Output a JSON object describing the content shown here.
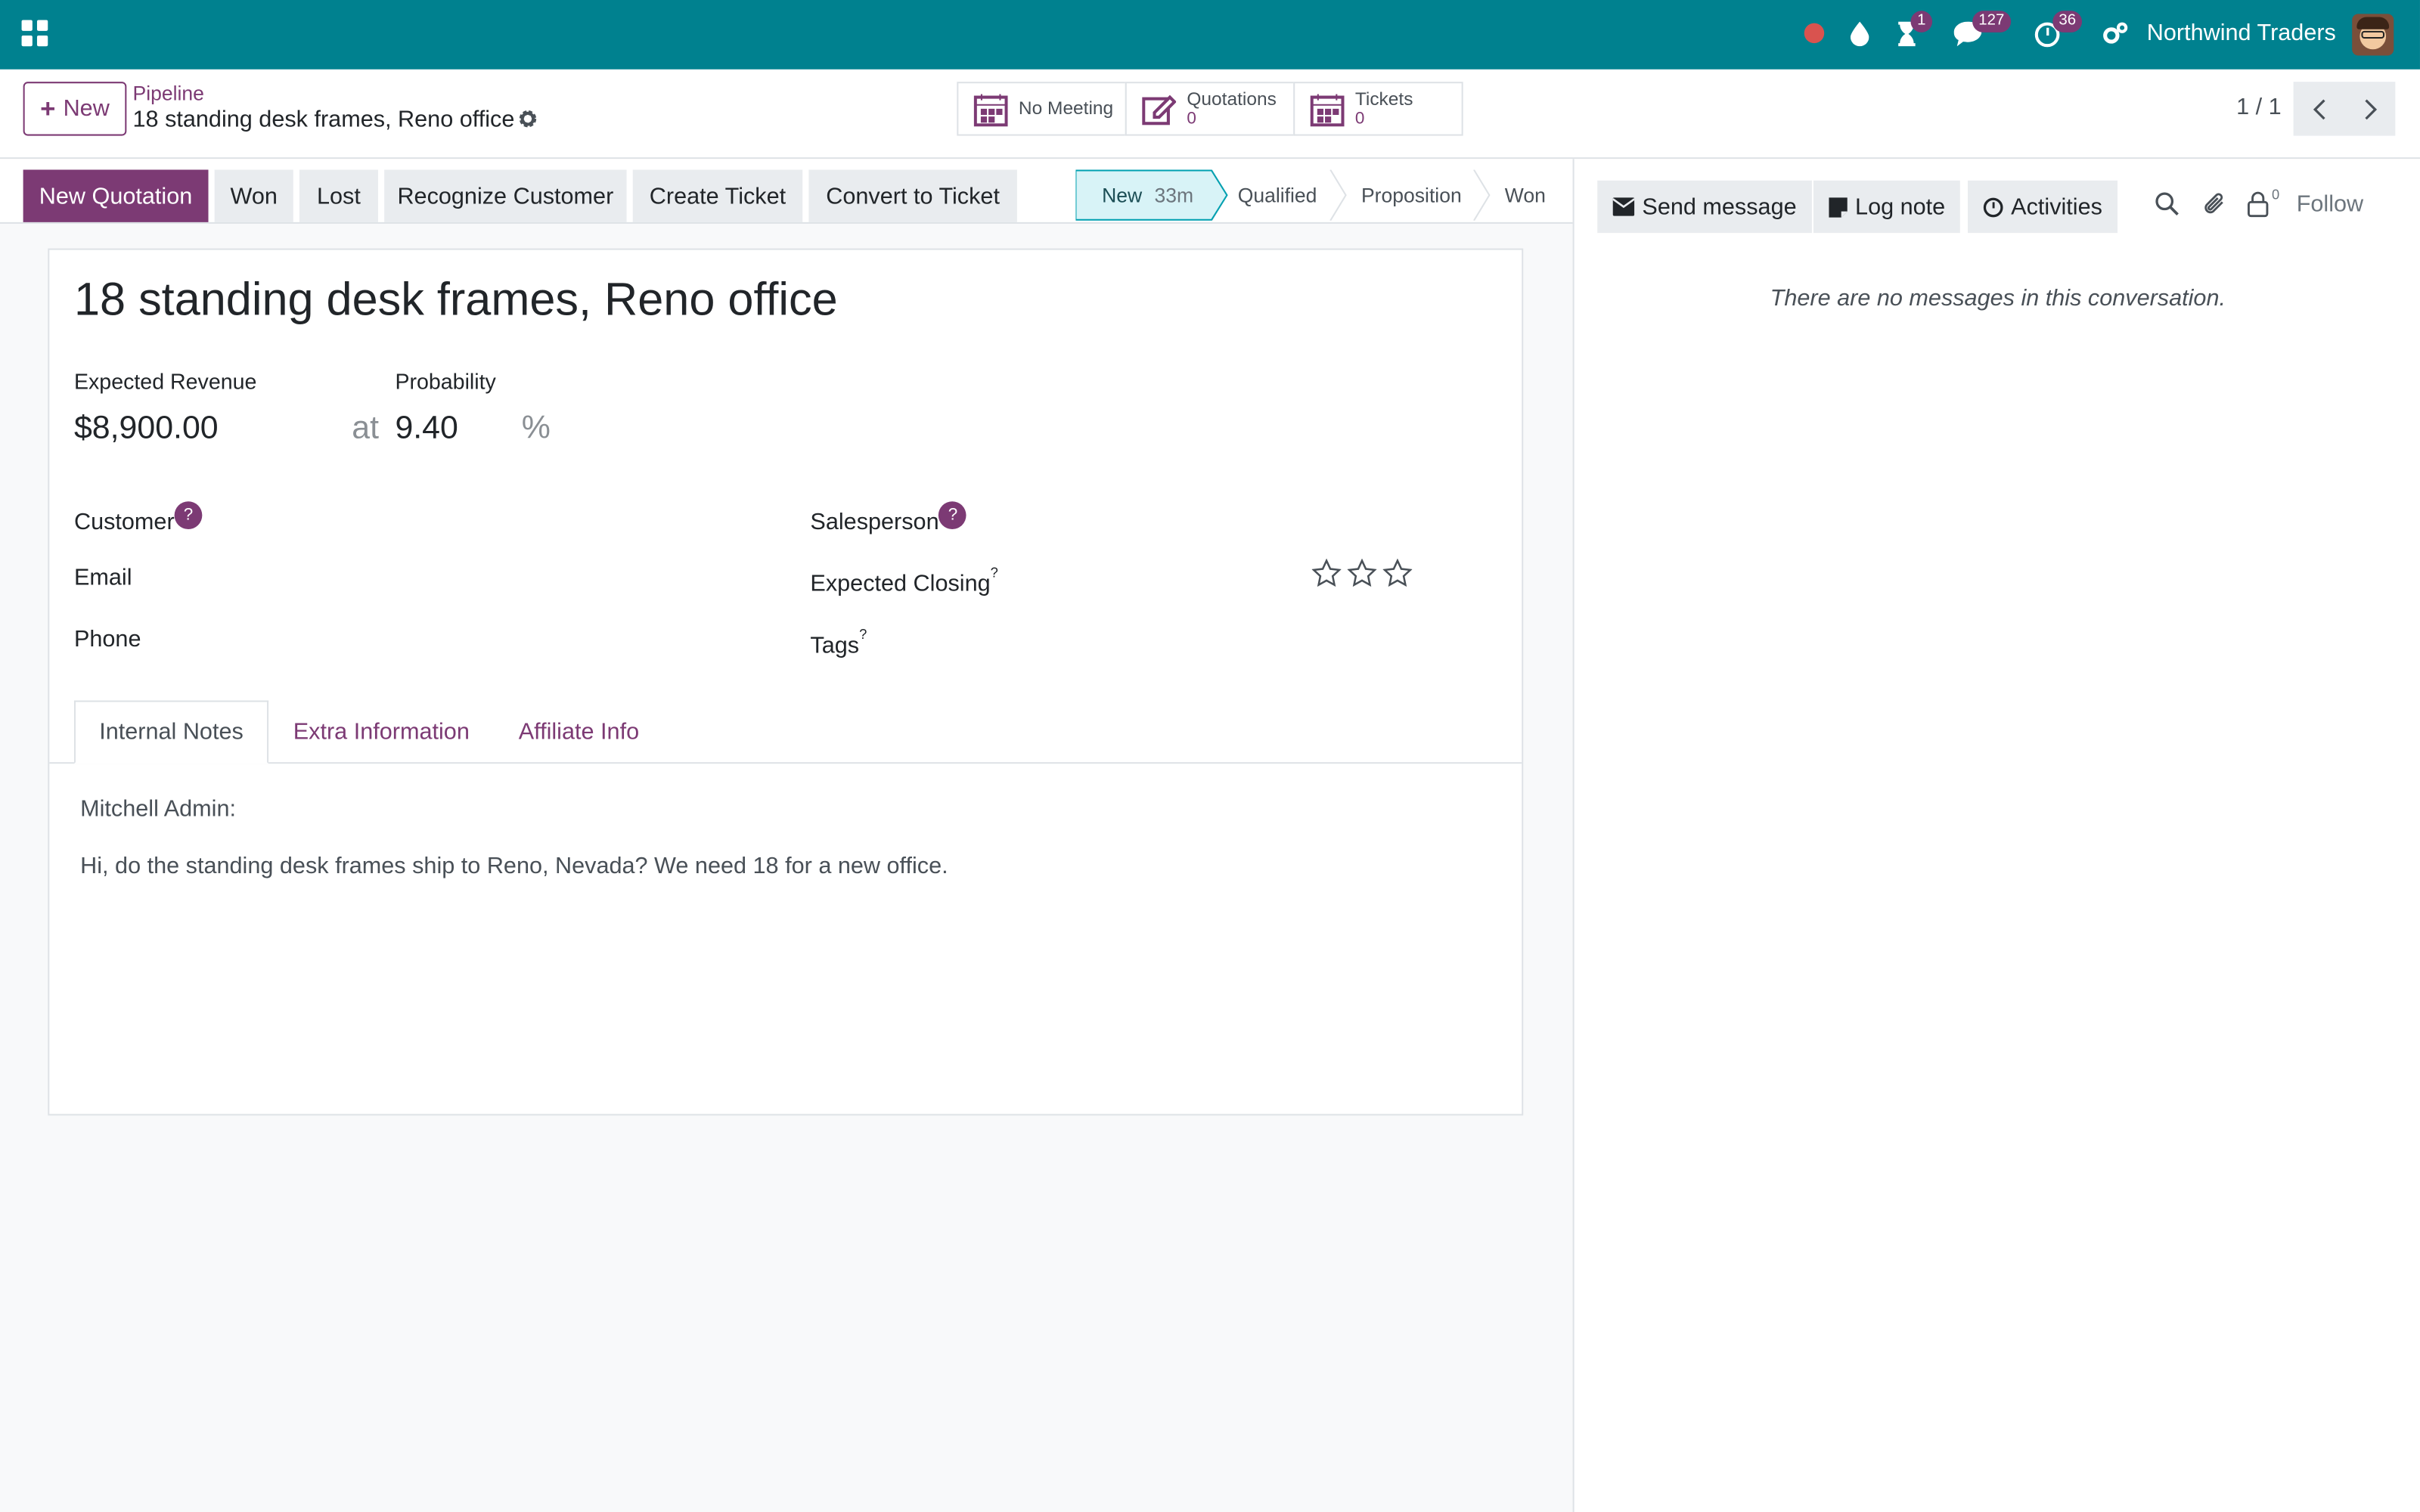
{
  "topnav": {
    "company": "Northwind Traders",
    "activity_badge": "1",
    "messages_badge": "127",
    "clock_badge": "36"
  },
  "control": {
    "new_label": "New",
    "breadcrumb_parent": "Pipeline",
    "breadcrumb_current": "18 standing desk frames, Reno office",
    "smart_buttons": [
      {
        "label": "No Meeting",
        "count": ""
      },
      {
        "label": "Quotations",
        "count": "0"
      },
      {
        "label": "Tickets",
        "count": "0"
      }
    ],
    "pager": "1 / 1"
  },
  "statusbar": {
    "buttons": [
      "New Quotation",
      "Won",
      "Lost",
      "Recognize Customer",
      "Create Ticket",
      "Convert to Ticket"
    ],
    "stages": [
      {
        "label": "New",
        "time": "33m",
        "active": true
      },
      {
        "label": "Qualified"
      },
      {
        "label": "Proposition"
      },
      {
        "label": "Won"
      }
    ]
  },
  "form": {
    "title": "18 standing desk frames, Reno office",
    "expected_revenue_label": "Expected Revenue",
    "expected_revenue": "$8,900.00",
    "at": "at",
    "probability_label": "Probability",
    "probability": "9.40",
    "percent": "%",
    "customer_label": "Customer",
    "email_label": "Email",
    "phone_label": "Phone",
    "salesperson_label": "Salesperson",
    "expected_closing_label": "Expected Closing",
    "tags_label": "Tags",
    "help_mark": "?",
    "priority_stars": 0,
    "tabs": [
      "Internal Notes",
      "Extra Information",
      "Affiliate Info"
    ],
    "notes": {
      "author": "Mitchell Admin:",
      "body": "Hi, do the standing desk frames ship to Reno, Nevada? We need 18 for a new office."
    }
  },
  "chatter": {
    "send_message": "Send message",
    "log_note": "Log note",
    "activities": "Activities",
    "followers_count": "0",
    "follow": "Follow",
    "empty": "There are no messages in this conversation."
  },
  "colors": {
    "navbar": "#00818f",
    "primary": "#7c3a74",
    "stage_active_bg": "#d8f3f7",
    "record_dot": "#d9534f"
  }
}
